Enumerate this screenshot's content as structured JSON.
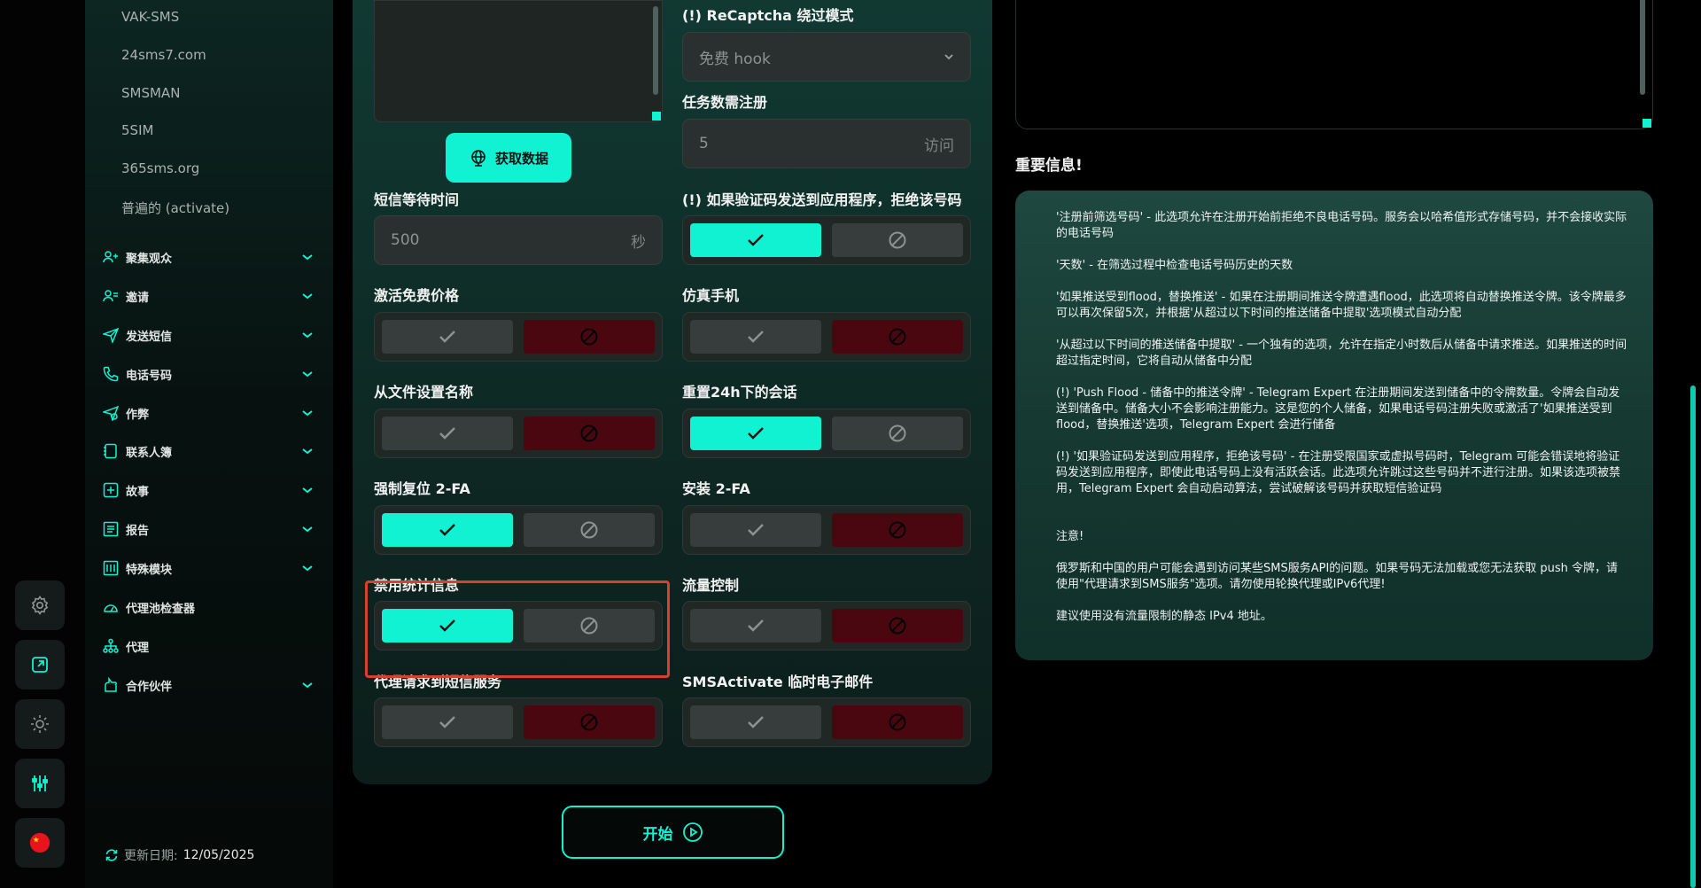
{
  "sidebar": {
    "providers": [
      "VAK-SMS",
      "24sms7.com",
      "SMSMAN",
      "5SIM",
      "365sms.org",
      "普遍的 (activate)"
    ],
    "nav": [
      {
        "label": "聚集观众",
        "icon": "users-icon",
        "expandable": true
      },
      {
        "label": "邀请",
        "icon": "user-plus-icon",
        "expandable": true
      },
      {
        "label": "发送短信",
        "icon": "send-icon",
        "expandable": true
      },
      {
        "label": "电话号码",
        "icon": "phone-icon",
        "expandable": true
      },
      {
        "label": "作弊",
        "icon": "cheat-icon",
        "expandable": true
      },
      {
        "label": "联系人簿",
        "icon": "contacts-icon",
        "expandable": true
      },
      {
        "label": "故事",
        "icon": "story-icon",
        "expandable": true
      },
      {
        "label": "报告",
        "icon": "report-icon",
        "expandable": true
      },
      {
        "label": "特殊模块",
        "icon": "module-icon",
        "expandable": true
      },
      {
        "label": "代理池检查器",
        "icon": "gauge-icon",
        "expandable": false
      },
      {
        "label": "代理",
        "icon": "network-icon",
        "expandable": false
      },
      {
        "label": "合作伙伴",
        "icon": "handshake-icon",
        "expandable": true
      }
    ],
    "update_label": "更新日期:",
    "update_date": "12/05/2025"
  },
  "form": {
    "fetch_button": "获取数据",
    "recaptcha_label": "(!) ReCaptcha 绕过模式",
    "recaptcha_value": "免费 hook",
    "tasks_label": "任务数需注册",
    "tasks_value": "5",
    "tasks_suffix": "访问",
    "sms_wait_label": "短信等待时间",
    "sms_wait_value": "500",
    "sms_wait_suffix": "秒",
    "reject_app_label": "(!) 如果验证码发送到应用程序，拒绝该号码",
    "free_price_label": "激活免费价格",
    "emulate_label": "仿真手机",
    "name_file_label": "从文件设置名称",
    "reset24_label": "重置24h下的会话",
    "force2fa_label": "强制复位 2-FA",
    "install2fa_label": "安装 2-FA",
    "disable_stats_label": "禁用统计信息",
    "traffic_label": "流量控制",
    "proxy_sms_label": "代理请求到短信服务",
    "temp_mail_label": "SMSActivate 临时电子邮件",
    "toggles": {
      "reject_app": "yes",
      "free_price": "no",
      "emulate": "no",
      "name_file": "no",
      "reset24": "yes",
      "force2fa": "yes",
      "install2fa": "no",
      "disable_stats": "yes",
      "traffic": "no",
      "proxy_sms": "no",
      "temp_mail": "no"
    },
    "start_button": "开始"
  },
  "info": {
    "title": "重要信息!",
    "paragraphs": [
      "'注册前筛选号码' - 此选项允许在注册开始前拒绝不良电话号码。服务会以哈希值形式存储号码，并不会接收实际的电话号码",
      "'天数' - 在筛选过程中检查电话号码历史的天数",
      "'如果推送受到flood，替换推送' - 如果在注册期间推送令牌遭遇flood，此选项将自动替换推送令牌。该令牌最多可以再次保留5次，并根据'从超过以下时间的推送储备中提取'选项模式自动分配",
      "'从超过以下时间的推送储备中提取' - 一个独有的选项，允许在指定小时数后从储备中请求推送。如果推送的时间超过指定时间，它将自动从储备中分配",
      "(!) 'Push Flood - 储备中的推送令牌' - Telegram Expert 在注册期间发送到储备中的令牌数量。令牌会自动发送到储备中。储备大小不会影响注册能力。这是您的个人储备，如果电话号码注册失败或激活了'如果推送受到flood，替换推送'选项，Telegram Expert 会进行储备",
      "(!) '如果验证码发送到应用程序，拒绝该号码' - 在注册受限国家或虚拟号码时，Telegram 可能会错误地将验证码发送到应用程序，即使此电话号码上没有活跃会话。此选项允许跳过这些号码并不进行注册。如果该选项被禁用，Telegram Expert 会自动启动算法，尝试破解该号码并获取短信验证码",
      "注意!",
      "俄罗斯和中国的用户可能会遇到访问某些SMS服务API的问题。如果号码无法加载或您无法获取 push 令牌，请使用\"代理请求到SMS服务\"选项。请勿使用轮换代理或IPv6代理!",
      "建议使用没有流量限制的静态 IPv4 地址。"
    ]
  },
  "colors": {
    "accent": "#10f2d2",
    "danger": "#4a0710",
    "highlight": "#d8402f"
  }
}
